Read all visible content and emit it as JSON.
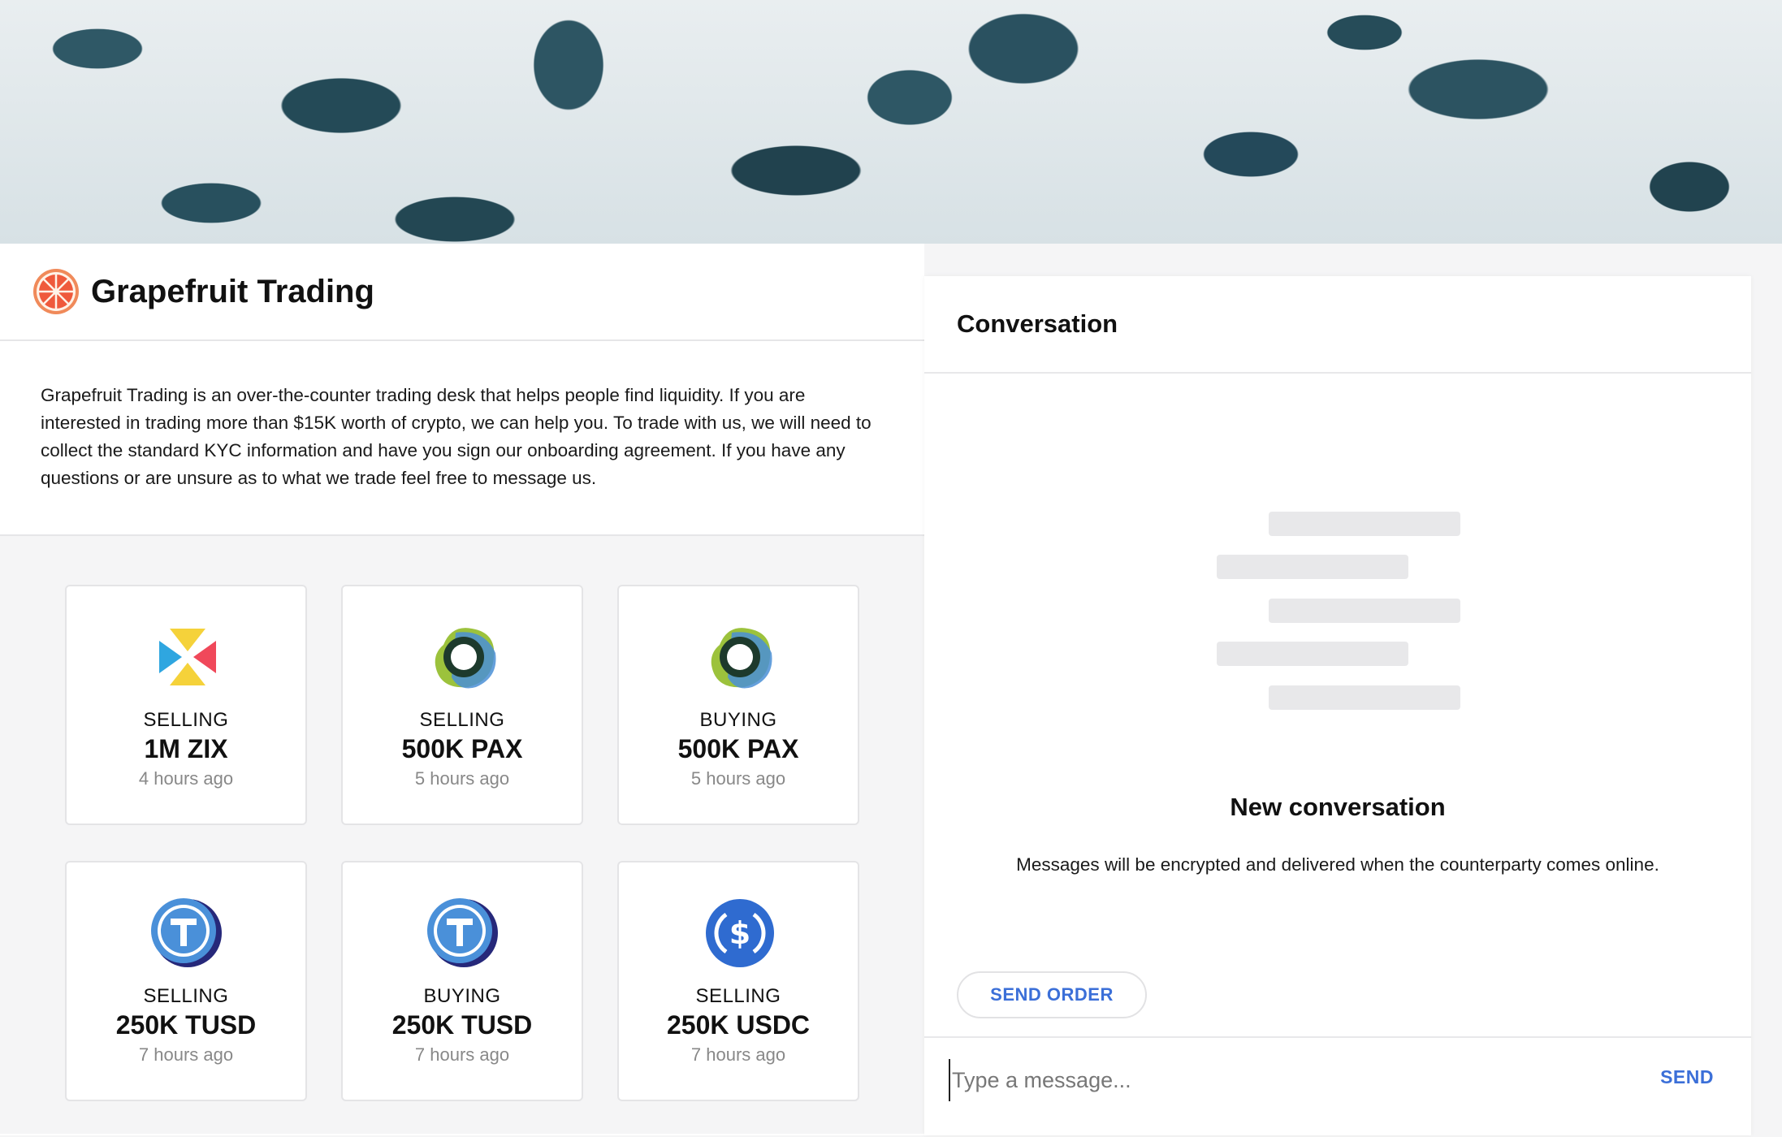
{
  "brand": {
    "name": "Grapefruit Trading",
    "description": "Grapefruit Trading is an over-the-counter trading desk that helps people find liquidity. If you are interested in trading more than $15K worth of crypto, we can help you. To trade with us, we will need to collect the standard KYC information and have you sign our onboarding agreement. If you have any questions or are unsure as to what we trade feel free to message us."
  },
  "orders": [
    {
      "action": "SELLING",
      "amount": "1M ZIX",
      "time": "4 hours ago",
      "icon": "zix-icon"
    },
    {
      "action": "SELLING",
      "amount": "500K PAX",
      "time": "5 hours ago",
      "icon": "pax-icon"
    },
    {
      "action": "BUYING",
      "amount": "500K PAX",
      "time": "5 hours ago",
      "icon": "pax-icon"
    },
    {
      "action": "SELLING",
      "amount": "250K TUSD",
      "time": "7 hours ago",
      "icon": "tusd-icon"
    },
    {
      "action": "BUYING",
      "amount": "250K TUSD",
      "time": "7 hours ago",
      "icon": "tusd-icon"
    },
    {
      "action": "SELLING",
      "amount": "250K USDC",
      "time": "7 hours ago",
      "icon": "usdc-icon"
    }
  ],
  "conversation": {
    "title": "Conversation",
    "empty_title": "New conversation",
    "empty_note": "Messages will be encrypted and delivered when the counterparty comes online.",
    "send_order_label": "SEND ORDER",
    "input_placeholder": "Type a message...",
    "send_label": "SEND"
  },
  "colors": {
    "accent": "#3b6fd8",
    "grapefruit": "#ef5a3c",
    "pax_green": "#9cc23c",
    "pax_blue": "#4a8fd6",
    "tusd_blue": "#4a90d9",
    "usdc_blue": "#2f6bd0"
  }
}
